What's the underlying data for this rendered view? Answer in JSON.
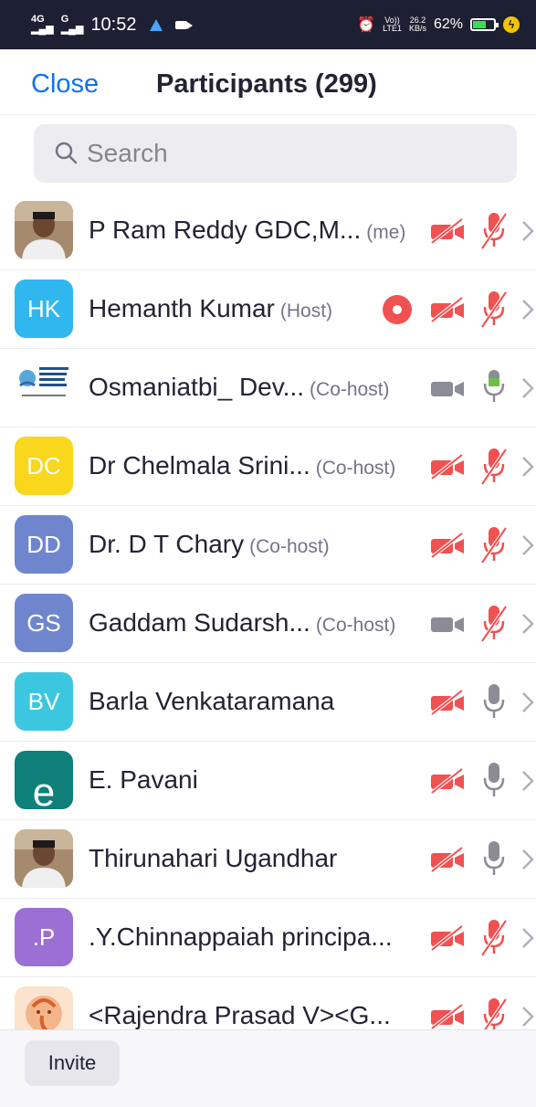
{
  "status_bar": {
    "net1": "4G",
    "net2": "G",
    "time": "10:52",
    "volte_top": "Vo))",
    "volte_bottom": "LTE1",
    "speed_top": "26.2",
    "speed_bottom": "KB/s",
    "battery": "62%",
    "battery_level": 0.62
  },
  "header": {
    "close_label": "Close",
    "title": "Participants (299)"
  },
  "search": {
    "placeholder": "Search"
  },
  "colors": {
    "accent": "#0e72ed",
    "muted_red": "#f05151",
    "mic_on_green": "#6cc04a",
    "icon_gray": "#8c8c96"
  },
  "participants": [
    {
      "name": "P Ram Reddy GDC,M...",
      "role": "(me)",
      "avatar": "photo",
      "initials": "",
      "color": "",
      "video": "off",
      "mic": "muted",
      "recording": false
    },
    {
      "name": "Hemanth Kumar",
      "role": "(Host)",
      "avatar": "initials",
      "initials": "HK",
      "color": "#31b7f0",
      "video": "off",
      "mic": "muted",
      "recording": true
    },
    {
      "name": "Osmaniatbi_ Dev...",
      "role": "(Co-host)",
      "avatar": "logo",
      "initials": "",
      "color": "",
      "video": "on",
      "mic": "on",
      "recording": false
    },
    {
      "name": "Dr Chelmala Srini...",
      "role": "(Co-host)",
      "avatar": "initials",
      "initials": "DC",
      "color": "#f9d71c",
      "video": "off",
      "mic": "muted",
      "recording": false
    },
    {
      "name": "Dr. D T Chary",
      "role": "(Co-host)",
      "avatar": "initials",
      "initials": "DD",
      "color": "#6f86cf",
      "video": "off",
      "mic": "muted",
      "recording": false
    },
    {
      "name": "Gaddam Sudarsh...",
      "role": "(Co-host)",
      "avatar": "initials",
      "initials": "GS",
      "color": "#6f86cf",
      "video": "on",
      "mic": "muted",
      "recording": false
    },
    {
      "name": "Barla Venkataramana",
      "role": "",
      "avatar": "initials",
      "initials": "BV",
      "color": "#3cc7e0",
      "video": "off",
      "mic": "off",
      "recording": false
    },
    {
      "name": "E. Pavani",
      "role": "",
      "avatar": "initials",
      "initials": "e",
      "color": "#0f7f7a",
      "video": "off",
      "mic": "off",
      "recording": false
    },
    {
      "name": "Thirunahari Ugandhar",
      "role": "",
      "avatar": "photo",
      "initials": "",
      "color": "",
      "video": "off",
      "mic": "off",
      "recording": false
    },
    {
      "name": ".Y.Chinnappaiah principa...",
      "role": "",
      "avatar": "initials",
      "initials": ".P",
      "color": "#9b6fd3",
      "video": "off",
      "mic": "muted",
      "recording": false
    },
    {
      "name": "<Rajendra Prasad V><G...",
      "role": "",
      "avatar": "illustration",
      "initials": "",
      "color": "",
      "video": "off",
      "mic": "muted",
      "recording": false
    }
  ],
  "logo_text": "Osmania Technology Business Incubator",
  "footer": {
    "invite_label": "Invite"
  }
}
